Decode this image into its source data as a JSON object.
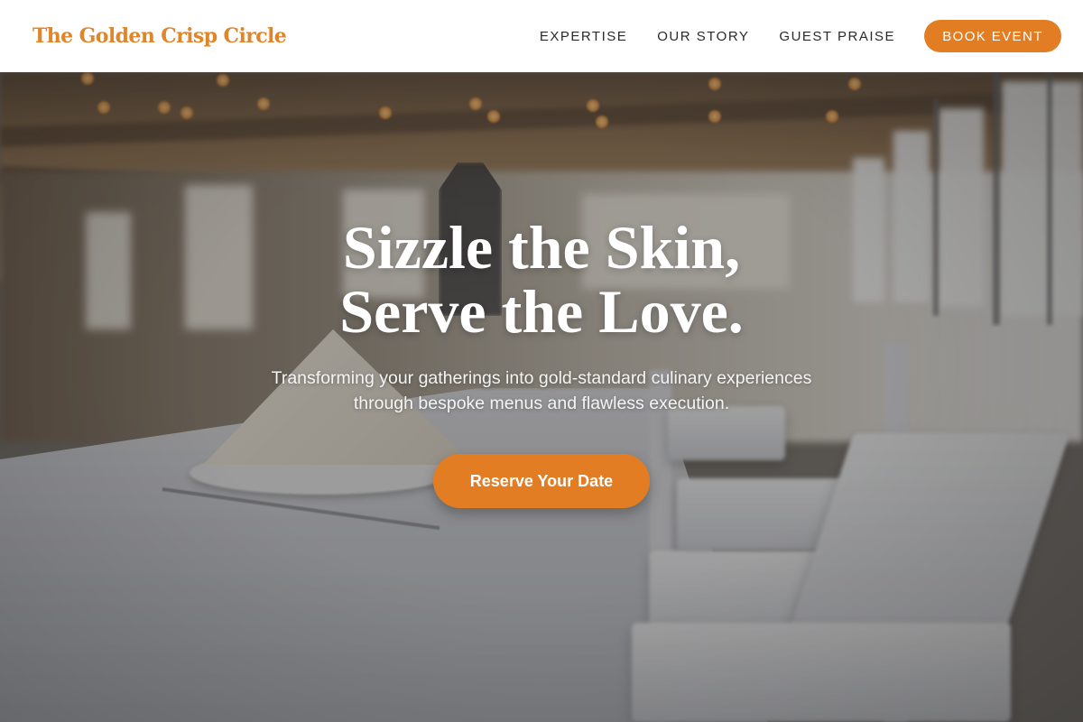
{
  "header": {
    "logo": "The Golden Crisp Circle",
    "nav": [
      {
        "label": "EXPERTISE"
      },
      {
        "label": "OUR STORY"
      },
      {
        "label": "GUEST PRAISE"
      }
    ],
    "cta_label": "BOOK EVENT"
  },
  "hero": {
    "headline_line1": "Sizzle the Skin,",
    "headline_line2": "Serve the Love.",
    "subtitle_line1": "Transforming your gatherings into gold-standard culinary experiences",
    "subtitle_line2": "through bespoke menus and flawless execution.",
    "cta_label": "Reserve Your Date",
    "background_image": "banquet-hall-table-setting"
  },
  "colors": {
    "accent": "#E37D24",
    "logo": "#E0852A",
    "nav_text": "#2A2A2A",
    "hero_text": "#FFFFFF"
  }
}
